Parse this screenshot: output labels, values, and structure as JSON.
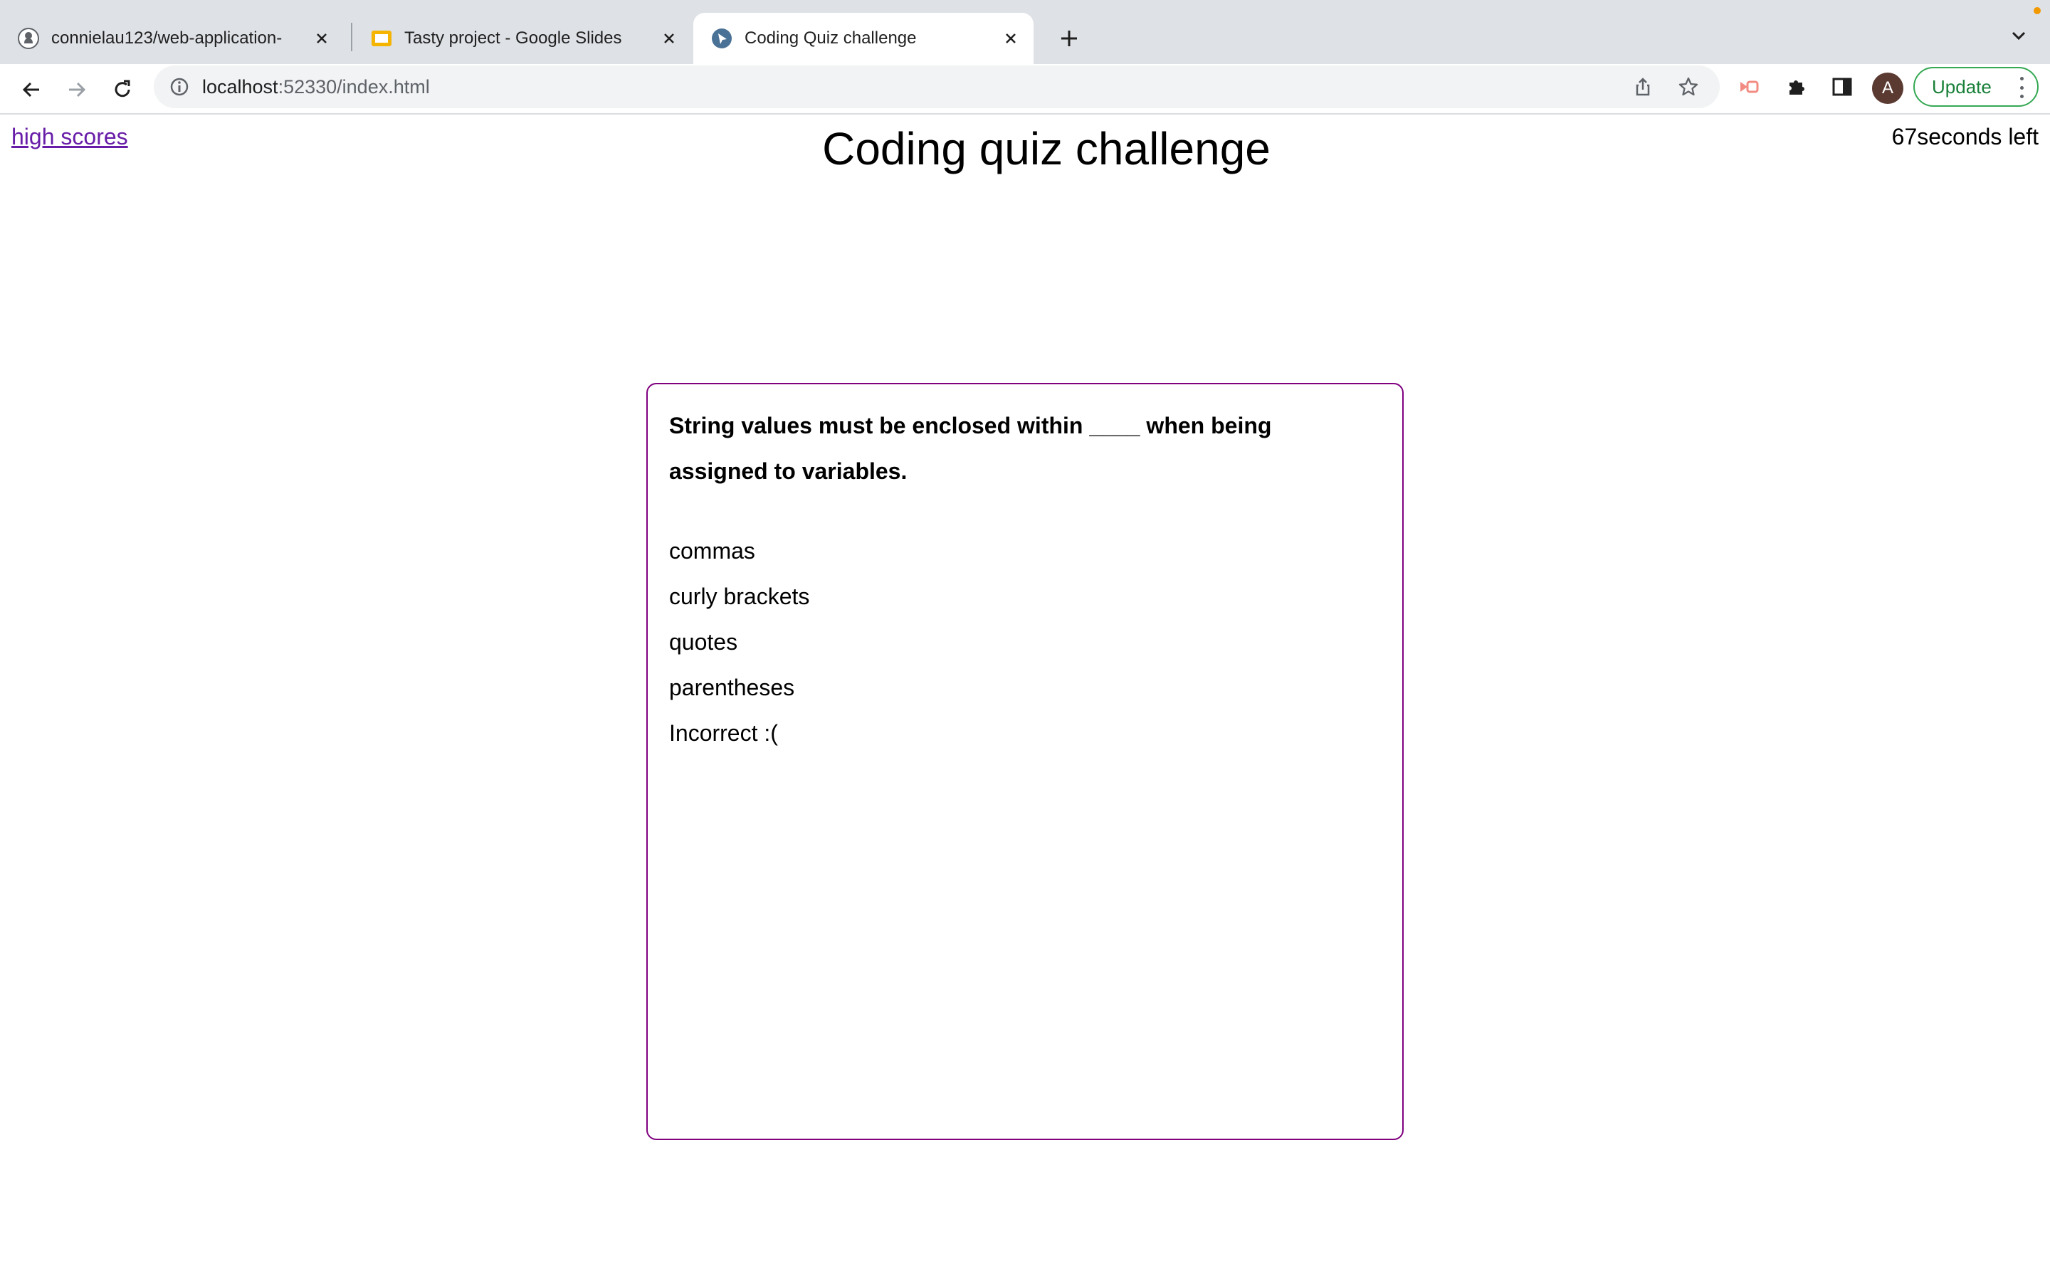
{
  "browser": {
    "tabs": [
      {
        "title": "connielau123/web-application-",
        "icon": "github-icon",
        "active": false
      },
      {
        "title": "Tasty project - Google Slides",
        "icon": "google-slides-icon",
        "active": false
      },
      {
        "title": "Coding Quiz challenge",
        "icon": "globe-favicon-icon",
        "active": true
      }
    ],
    "address": {
      "host": "localhost",
      "path": ":52330/index.html"
    },
    "avatar_letter": "A",
    "update_label": "Update",
    "accent_update": "#34a853",
    "notification_color": "#f29900"
  },
  "page": {
    "high_scores_link": "high scores",
    "title": "Coding quiz challenge",
    "timer": {
      "seconds": "67",
      "suffix": "seconds left"
    },
    "quiz": {
      "question": "String values must be enclosed within ____ when being assigned to variables.",
      "choices": [
        "commas",
        "curly brackets",
        "quotes",
        "parentheses"
      ],
      "feedback": "Incorrect :("
    },
    "card_border_color": "#800080",
    "link_color": "#681da8"
  }
}
